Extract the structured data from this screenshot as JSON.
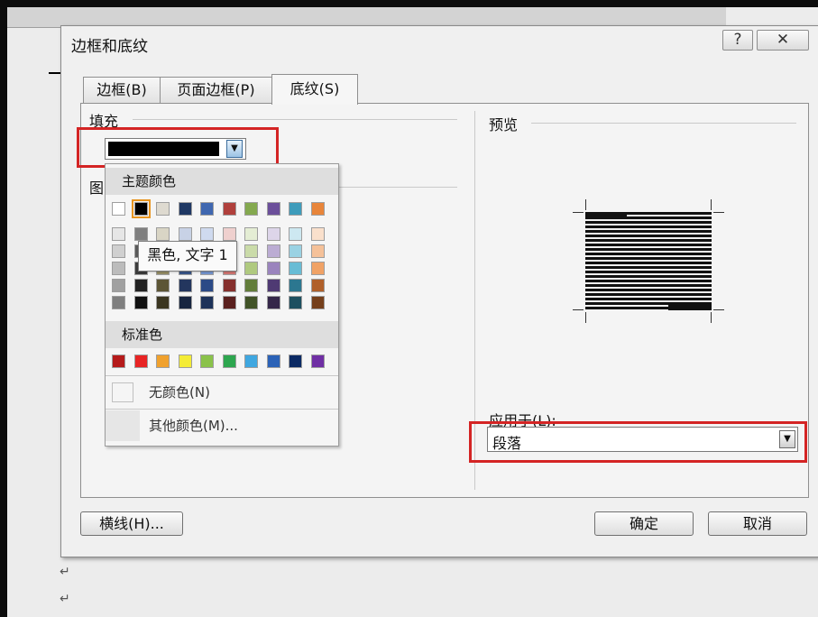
{
  "document": {
    "paragraph_marks": [
      "↵",
      "↵"
    ]
  },
  "dialog": {
    "title": "边框和底纹",
    "help_label": "?",
    "close_label": "✕",
    "tabs": [
      {
        "label": "边框(B)"
      },
      {
        "label": "页面边框(P)"
      },
      {
        "label": "底纹(S)"
      }
    ],
    "fill": {
      "label": "填充",
      "selected_color": "#000000"
    },
    "pattern_label_partial": "图",
    "color_popup": {
      "theme_header": "主题颜色",
      "theme_row": [
        "#ffffff",
        "#000000",
        "#dedad0",
        "#1f3864",
        "#3f67b0",
        "#b0403c",
        "#84a94f",
        "#6b4f9a",
        "#3e9cbb",
        "#e8853a"
      ],
      "theme_tints": [
        [
          "#e6e6e6",
          "#d0d0d0",
          "#bcbcbc",
          "#a0a0a0",
          "#7f7f7f"
        ],
        [
          "#7f7f7f",
          "#5a5a5a",
          "#3c3c3c",
          "#222222",
          "#111111"
        ],
        [
          "#d9d5c5",
          "#c4be9f",
          "#958d65",
          "#5c5535",
          "#3a3520"
        ],
        [
          "#c8d2e6",
          "#8fa4c9",
          "#3a5588",
          "#23365e",
          "#172540"
        ],
        [
          "#cfdaef",
          "#a3b9e0",
          "#7595cf",
          "#2b4a86",
          "#1d3259"
        ],
        [
          "#efd0ce",
          "#e0a3a0",
          "#d27672",
          "#86302d",
          "#5a201e"
        ],
        [
          "#e4edd4",
          "#cadba9",
          "#afc97f",
          "#627d3a",
          "#415327"
        ],
        [
          "#ddd5e9",
          "#bbacd3",
          "#9a84bd",
          "#4f3a73",
          "#352749"
        ],
        [
          "#cde8f1",
          "#9ad2e3",
          "#68bcd5",
          "#2c7790",
          "#1d4f60"
        ],
        [
          "#fae0cc",
          "#f5c199",
          "#f0a266",
          "#b0602a",
          "#753f1b"
        ]
      ],
      "tooltip": "黑色, 文字 1",
      "standard_header": "标准色",
      "standard_colors": [
        "#b51a1a",
        "#e82424",
        "#f0a12d",
        "#f4ec36",
        "#8ac24a",
        "#2da64f",
        "#3fa7e0",
        "#2b62b7",
        "#0b2a64",
        "#6f2fa4"
      ],
      "no_color_label": "无颜色(N)",
      "more_colors_label": "其他颜色(M)..."
    },
    "preview_label": "预览",
    "apply_to_label": "应用于(L):",
    "apply_to_value": "段落",
    "hline_button": "横线(H)...",
    "ok_button": "确定",
    "cancel_button": "取消"
  }
}
